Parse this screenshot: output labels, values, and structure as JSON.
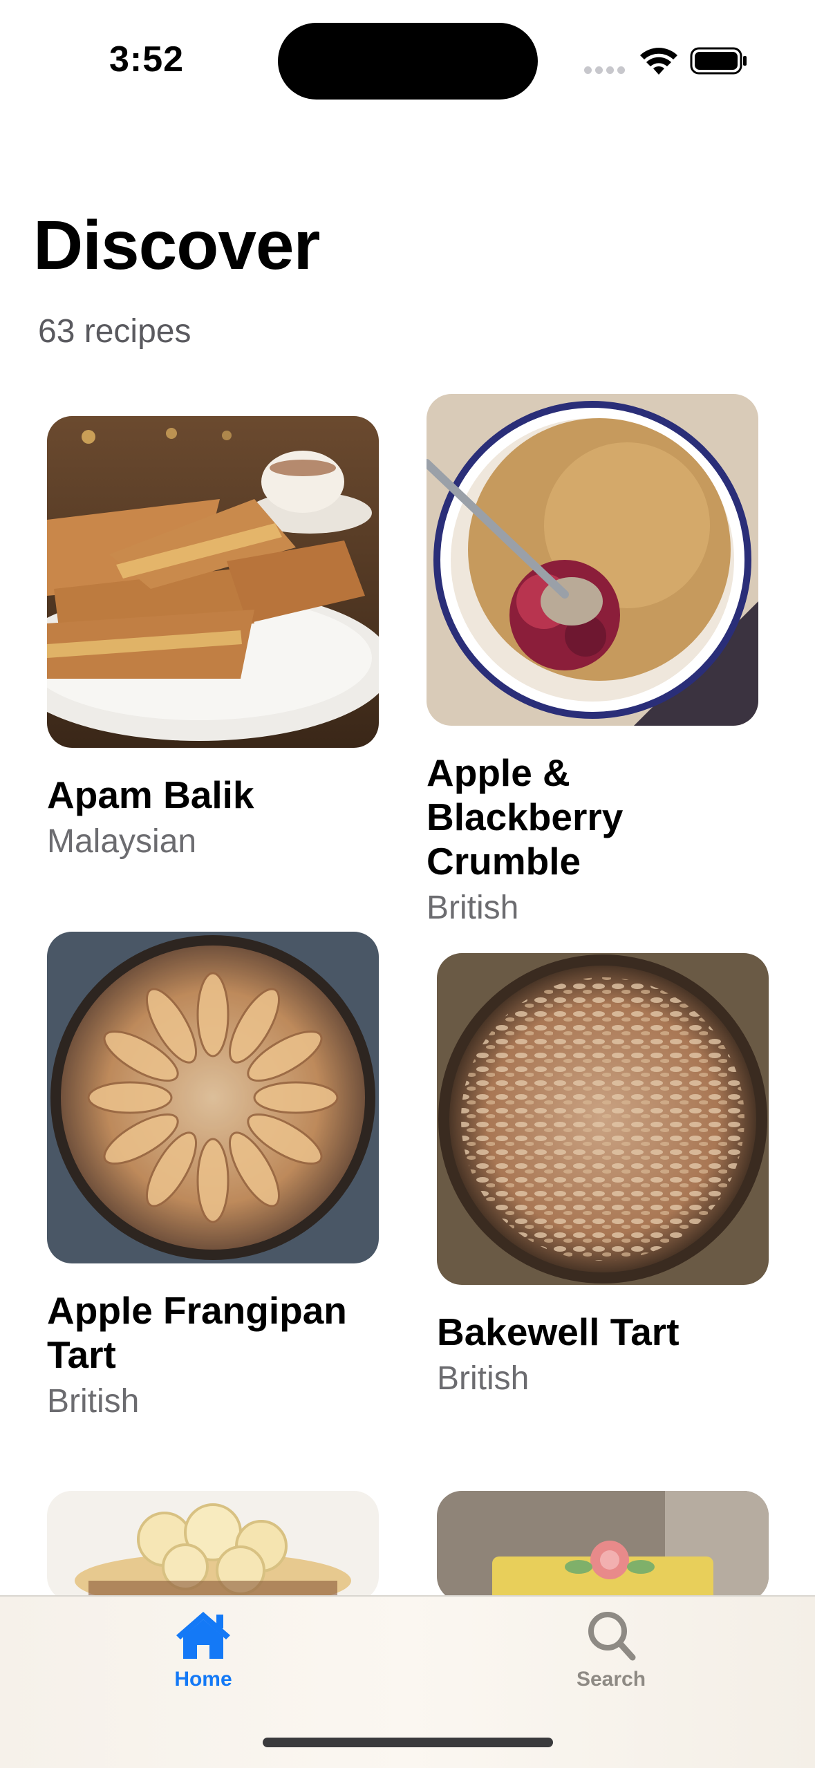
{
  "status_bar": {
    "time": "3:52"
  },
  "header": {
    "title": "Discover",
    "count": "63 recipes"
  },
  "recipes": [
    {
      "name": "Apam Balik",
      "cuisine": "Malaysian"
    },
    {
      "name": "Apple & Blackberry Crumble",
      "cuisine": "British"
    },
    {
      "name": "Apple Frangipan Tart",
      "cuisine": "British"
    },
    {
      "name": "Bakewell Tart",
      "cuisine": "British"
    },
    {
      "name": "",
      "cuisine": ""
    },
    {
      "name": "",
      "cuisine": ""
    }
  ],
  "tab_bar": {
    "home_label": "Home",
    "search_label": "Search"
  },
  "colors": {
    "accent": "#1479F6",
    "inactive_tab": "#8E8A84",
    "secondary_text": "#6C6C70"
  },
  "icons": {
    "home": "house-fill-icon",
    "search": "magnifying-glass-icon"
  }
}
